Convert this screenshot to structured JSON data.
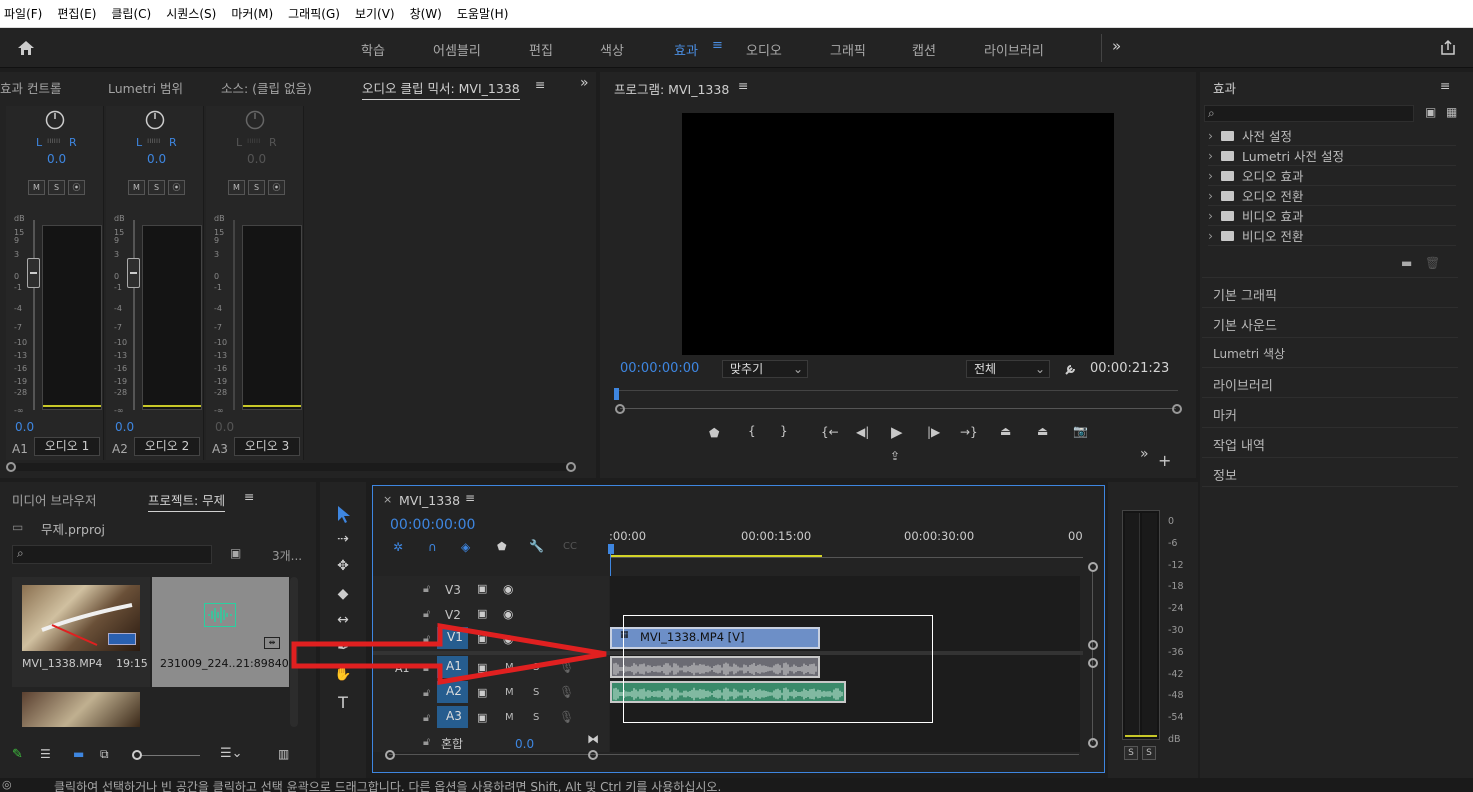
{
  "menubar": [
    "파일(F)",
    "편집(E)",
    "클립(C)",
    "시퀀스(S)",
    "마커(M)",
    "그래픽(G)",
    "보기(V)",
    "창(W)",
    "도움말(H)"
  ],
  "workspaces": {
    "items": [
      "학습",
      "어셈블리",
      "편집",
      "색상",
      "효과",
      "오디오",
      "그래픽",
      "캡션",
      "라이브러리"
    ],
    "active": "효과"
  },
  "mixer_panel": {
    "tabs": [
      "효과 컨트롤",
      "Lumetri 범위",
      "소스: (클립 없음)",
      "오디오 클립 믹서: MVI_1338"
    ],
    "channels": [
      {
        "id": "A1",
        "name": "오디오 1",
        "pan": "0.0",
        "level": "0.0",
        "L": "L",
        "R": "R"
      },
      {
        "id": "A2",
        "name": "오디오 2",
        "pan": "0.0",
        "level": "0.0",
        "L": "L",
        "R": "R"
      },
      {
        "id": "A3",
        "name": "오디오 3",
        "pan": "0.0",
        "level": "0.0",
        "L": "L",
        "R": "R"
      }
    ],
    "db_label": "dB",
    "db_scale": [
      "15",
      "9",
      "3",
      "0",
      "-1",
      "-4",
      "-7",
      "-10",
      "-13",
      "-16",
      "-19",
      "-28",
      "-∞"
    ],
    "msr": [
      "M",
      "S",
      "⦿"
    ]
  },
  "program_monitor": {
    "title": "프로그램: MVI_1338",
    "timecode": "00:00:00:00",
    "fit": "맞추기",
    "quality": "전체",
    "duration": "00:00:21:23"
  },
  "effects_panel": {
    "title": "효과",
    "tree": [
      "사전 설정",
      "Lumetri 사전 설정",
      "오디오 효과",
      "오디오 전환",
      "비디오 효과",
      "비디오 전환"
    ],
    "sections": [
      "기본 그래픽",
      "기본 사운드",
      "Lumetri 색상",
      "라이브러리",
      "마커",
      "작업 내역",
      "정보"
    ]
  },
  "project_panel": {
    "tabs": [
      "미디어 브라우저",
      "프로젝트: 무제"
    ],
    "file": "무제.prproj",
    "count": "3개...",
    "items": [
      {
        "name": "MVI_1338.MP4",
        "duration": "19:15"
      },
      {
        "name": "231009_224...",
        "duration": "21:89840"
      }
    ]
  },
  "timeline": {
    "tab": "MVI_1338",
    "timecode": "00:00:00:00",
    "ruler": [
      ":00:00",
      "00:00:15:00",
      "00:00:30:00",
      "00"
    ],
    "video_tracks": [
      "V3",
      "V2",
      "V1"
    ],
    "audio_tracks": [
      "A1",
      "A2",
      "A3"
    ],
    "mix_label": "혼합",
    "mix_value": "0.0",
    "clip_video": "MVI_1338.MP4 [V]",
    "source_patch": "A1"
  },
  "audio_meter": {
    "scale": [
      "0",
      "-6",
      "-12",
      "-18",
      "-24",
      "-30",
      "-36",
      "-42",
      "-48",
      "-54",
      "dB"
    ],
    "solo": [
      "S",
      "S"
    ]
  },
  "status_bar": "클릭하여 선택하거나 빈 공간을 클릭하고 선택 윤곽으로 드래그합니다. 다른 옵션을 사용하려면 Shift, Alt 및 Ctrl 키를 사용하십시오.",
  "colors": {
    "accent": "#3e86e0",
    "video_clip": "#6d8fc7",
    "audio_clip_a1": "#6b6b73",
    "audio_clip_a2": "#3a8a6a",
    "annotation_arrow": "#e02020"
  }
}
